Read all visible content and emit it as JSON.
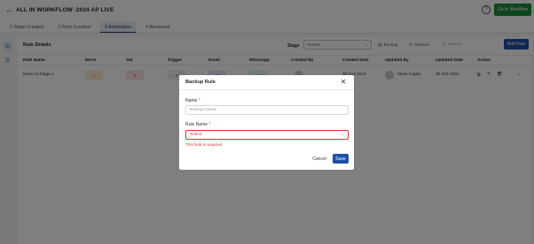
{
  "header": {
    "title": "ALL IN WORKFLOW -2024 AP LIVE",
    "goto_label": "Go to Workflow"
  },
  "tabs": [
    {
      "label": "1 Stage Creation",
      "active": false
    },
    {
      "label": "2 Form Creation",
      "active": false
    },
    {
      "label": "3 Automation",
      "active": true
    },
    {
      "label": "4 Advanced",
      "active": false
    }
  ],
  "panel": {
    "title": "Rule Details",
    "stage_label": "Stage",
    "stage_value": "Answer",
    "backup_label": "Backup",
    "restore_label": "Restore",
    "search_placeholder": "Search",
    "add_rule_label": "Add Rule"
  },
  "table": {
    "headers": [
      "Rule Name",
      "Move",
      "Set",
      "Trigger",
      "Email",
      "Whatsapp",
      "Created By",
      "Created Date",
      "Updated By",
      "Updated Date",
      "Action"
    ],
    "rows": [
      {
        "rule_name": "Move to Stage 1",
        "move": "1",
        "set": "0",
        "trigger": "0",
        "email": "0",
        "whatsapp": "0",
        "created_date": "30-Oct-2024",
        "updated_by": "Vikas Gupta",
        "updated_date": "30-Oct-2024"
      }
    ]
  },
  "modal": {
    "title": "Backup Rule",
    "name_label": "Name",
    "name_placeholder": "Backup Name",
    "rule_name_label": "Rule Name",
    "rule_select_value": "Select",
    "error_text": "This field is required",
    "required_mark": "*",
    "cancel_label": "Cancel",
    "save_label": "Save"
  },
  "colors": {
    "primary": "#1f4fa8",
    "success": "#1f8a3a",
    "error": "#d33333"
  }
}
